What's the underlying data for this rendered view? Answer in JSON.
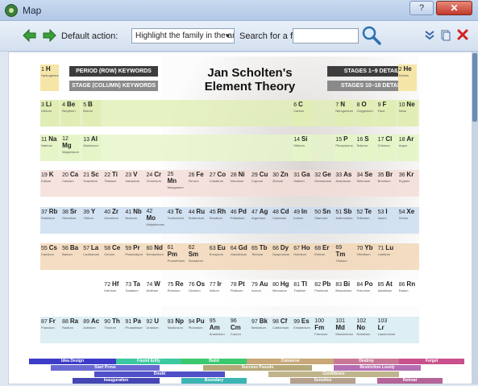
{
  "window": {
    "title": "Map",
    "help_label": "?",
    "close_label": "✕"
  },
  "toolbar": {
    "default_action_label": "Default action:",
    "default_action_value": "Highlight the family in the analysis",
    "search_label": "Search for a family:",
    "search_value": ""
  },
  "chart": {
    "title_line1": "Jan Scholten's",
    "title_line2": "Element Theory",
    "btn_period": "PERIOD (ROW) KEYWORDS",
    "btn_stage": "STAGE (COLUMN) KEYWORDS",
    "btn_stages_1_9": "STAGES 1–9 DETAIL",
    "btn_stages_10_18": "STAGES 10–18 DETAIL"
  },
  "elements": [
    {
      "n": "1",
      "s": "H",
      "name": "Hydrogenium",
      "row": 0,
      "col": 0
    },
    {
      "n": "2",
      "s": "He",
      "name": "Helium",
      "row": 0,
      "col": 17
    },
    {
      "n": "3",
      "s": "Li",
      "name": "Lithium",
      "row": 1,
      "col": 0
    },
    {
      "n": "4",
      "s": "Be",
      "name": "Beryllium",
      "row": 1,
      "col": 1
    },
    {
      "n": "5",
      "s": "B",
      "name": "Borum",
      "row": 1,
      "col": 2
    },
    {
      "n": "6",
      "s": "C",
      "name": "Carbon",
      "row": 1,
      "col": 12
    },
    {
      "n": "7",
      "s": "N",
      "name": "Nitrogenium",
      "row": 1,
      "col": 14
    },
    {
      "n": "8",
      "s": "O",
      "name": "Oxygenium",
      "row": 1,
      "col": 15
    },
    {
      "n": "9",
      "s": "F",
      "name": "Fluor",
      "row": 1,
      "col": 16
    },
    {
      "n": "10",
      "s": "Ne",
      "name": "Neon",
      "row": 1,
      "col": 17
    },
    {
      "n": "11",
      "s": "Na",
      "name": "Natrium",
      "row": 2,
      "col": 0
    },
    {
      "n": "12",
      "s": "Mg",
      "name": "Magnesium",
      "row": 2,
      "col": 1
    },
    {
      "n": "13",
      "s": "Al",
      "name": "Aluminium",
      "row": 2,
      "col": 2
    },
    {
      "n": "14",
      "s": "Si",
      "name": "Silicium",
      "row": 2,
      "col": 12
    },
    {
      "n": "15",
      "s": "P",
      "name": "Phosphorus",
      "row": 2,
      "col": 14
    },
    {
      "n": "16",
      "s": "S",
      "name": "Sulphur",
      "row": 2,
      "col": 15
    },
    {
      "n": "17",
      "s": "Cl",
      "name": "Chlorum",
      "row": 2,
      "col": 16
    },
    {
      "n": "18",
      "s": "Ar",
      "name": "Argon",
      "row": 2,
      "col": 17
    },
    {
      "n": "19",
      "s": "K",
      "name": "Kalium",
      "row": 3,
      "col": 0
    },
    {
      "n": "20",
      "s": "Ca",
      "name": "Calcium",
      "row": 3,
      "col": 1
    },
    {
      "n": "21",
      "s": "Sc",
      "name": "Scandium",
      "row": 3,
      "col": 2
    },
    {
      "n": "22",
      "s": "Ti",
      "name": "Titanium",
      "row": 3,
      "col": 3
    },
    {
      "n": "23",
      "s": "V",
      "name": "Vanadium",
      "row": 3,
      "col": 4
    },
    {
      "n": "24",
      "s": "Cr",
      "name": "Chromium",
      "row": 3,
      "col": 5
    },
    {
      "n": "25",
      "s": "Mn",
      "name": "Manganum",
      "row": 3,
      "col": 6
    },
    {
      "n": "26",
      "s": "Fe",
      "name": "Ferrum",
      "row": 3,
      "col": 7
    },
    {
      "n": "27",
      "s": "Co",
      "name": "Cobaltum",
      "row": 3,
      "col": 8
    },
    {
      "n": "28",
      "s": "Ni",
      "name": "Niccolum",
      "row": 3,
      "col": 9
    },
    {
      "n": "29",
      "s": "Cu",
      "name": "Cuprum",
      "row": 3,
      "col": 10
    },
    {
      "n": "30",
      "s": "Zn",
      "name": "Zincum",
      "row": 3,
      "col": 11
    },
    {
      "n": "31",
      "s": "Ga",
      "name": "Gallium",
      "row": 3,
      "col": 12
    },
    {
      "n": "32",
      "s": "Ge",
      "name": "Germanium",
      "row": 3,
      "col": 13
    },
    {
      "n": "33",
      "s": "As",
      "name": "Arsenicum",
      "row": 3,
      "col": 14
    },
    {
      "n": "34",
      "s": "Se",
      "name": "Selenium",
      "row": 3,
      "col": 15
    },
    {
      "n": "35",
      "s": "Br",
      "name": "Bromium",
      "row": 3,
      "col": 16
    },
    {
      "n": "36",
      "s": "Kr",
      "name": "Krypton",
      "row": 3,
      "col": 17
    },
    {
      "n": "37",
      "s": "Rb",
      "name": "Rubidium",
      "row": 4,
      "col": 0
    },
    {
      "n": "38",
      "s": "Sr",
      "name": "Strontium",
      "row": 4,
      "col": 1
    },
    {
      "n": "39",
      "s": "Y",
      "name": "Yttrium",
      "row": 4,
      "col": 2
    },
    {
      "n": "40",
      "s": "Zr",
      "name": "Zirconium",
      "row": 4,
      "col": 3
    },
    {
      "n": "41",
      "s": "Nb",
      "name": "Niobium",
      "row": 4,
      "col": 4
    },
    {
      "n": "42",
      "s": "Mo",
      "name": "Molybdenum",
      "row": 4,
      "col": 5
    },
    {
      "n": "43",
      "s": "Tc",
      "name": "Technetium",
      "row": 4,
      "col": 6
    },
    {
      "n": "44",
      "s": "Ru",
      "name": "Ruthenium",
      "row": 4,
      "col": 7
    },
    {
      "n": "45",
      "s": "Rh",
      "name": "Rhodium",
      "row": 4,
      "col": 8
    },
    {
      "n": "46",
      "s": "Pd",
      "name": "Palladium",
      "row": 4,
      "col": 9
    },
    {
      "n": "47",
      "s": "Ag",
      "name": "Argentum",
      "row": 4,
      "col": 10
    },
    {
      "n": "48",
      "s": "Cd",
      "name": "Cadmium",
      "row": 4,
      "col": 11
    },
    {
      "n": "49",
      "s": "In",
      "name": "Indium",
      "row": 4,
      "col": 12
    },
    {
      "n": "50",
      "s": "Sn",
      "name": "Stannum",
      "row": 4,
      "col": 13
    },
    {
      "n": "51",
      "s": "Sb",
      "name": "Antimonium",
      "row": 4,
      "col": 14
    },
    {
      "n": "52",
      "s": "Te",
      "name": "Tellurium",
      "row": 4,
      "col": 15
    },
    {
      "n": "53",
      "s": "I",
      "name": "Iodum",
      "row": 4,
      "col": 16
    },
    {
      "n": "54",
      "s": "Xe",
      "name": "Xenon",
      "row": 4,
      "col": 17
    },
    {
      "n": "55",
      "s": "Cs",
      "name": "Caesium",
      "row": 5,
      "col": 0
    },
    {
      "n": "56",
      "s": "Ba",
      "name": "Barium",
      "row": 5,
      "col": 1
    },
    {
      "n": "57",
      "s": "La",
      "name": "Lanthanum",
      "row": 5,
      "col": 2
    },
    {
      "n": "58",
      "s": "Ce",
      "name": "Cerium",
      "row": 5,
      "col": 3
    },
    {
      "n": "59",
      "s": "Pr",
      "name": "Praseodymium",
      "row": 5,
      "col": 4
    },
    {
      "n": "60",
      "s": "Nd",
      "name": "Neodymium",
      "row": 5,
      "col": 5
    },
    {
      "n": "61",
      "s": "Pm",
      "name": "Promethium",
      "row": 5,
      "col": 6
    },
    {
      "n": "62",
      "s": "Sm",
      "name": "Samarium",
      "row": 5,
      "col": 7
    },
    {
      "n": "63",
      "s": "Eu",
      "name": "Europium",
      "row": 5,
      "col": 8
    },
    {
      "n": "64",
      "s": "Gd",
      "name": "Gadolinium",
      "row": 5,
      "col": 9
    },
    {
      "n": "65",
      "s": "Tb",
      "name": "Terbium",
      "row": 5,
      "col": 10
    },
    {
      "n": "66",
      "s": "Dy",
      "name": "Dysprosium",
      "row": 5,
      "col": 11
    },
    {
      "n": "67",
      "s": "Ho",
      "name": "Holmium",
      "row": 5,
      "col": 12
    },
    {
      "n": "68",
      "s": "Er",
      "name": "Erbium",
      "row": 5,
      "col": 13
    },
    {
      "n": "69",
      "s": "Tm",
      "name": "Thulium",
      "row": 5,
      "col": 14
    },
    {
      "n": "70",
      "s": "Yb",
      "name": "Ytterbium",
      "row": 5,
      "col": 15
    },
    {
      "n": "71",
      "s": "Lu",
      "name": "Lutetium",
      "row": 5,
      "col": 16
    },
    {
      "n": "72",
      "s": "Hf",
      "name": "Hafnium",
      "row": 6,
      "col": 3
    },
    {
      "n": "73",
      "s": "Ta",
      "name": "Tantalum",
      "row": 6,
      "col": 4
    },
    {
      "n": "74",
      "s": "W",
      "name": "Wolfram",
      "row": 6,
      "col": 5
    },
    {
      "n": "75",
      "s": "Re",
      "name": "Rhenium",
      "row": 6,
      "col": 6
    },
    {
      "n": "76",
      "s": "Os",
      "name": "Osmium",
      "row": 6,
      "col": 7
    },
    {
      "n": "77",
      "s": "Ir",
      "name": "Iridium",
      "row": 6,
      "col": 8
    },
    {
      "n": "78",
      "s": "Pt",
      "name": "Platinum",
      "row": 6,
      "col": 9
    },
    {
      "n": "79",
      "s": "Au",
      "name": "Aurum",
      "row": 6,
      "col": 10
    },
    {
      "n": "80",
      "s": "Hg",
      "name": "Mercurius",
      "row": 6,
      "col": 11
    },
    {
      "n": "81",
      "s": "Tl",
      "name": "Thallium",
      "row": 6,
      "col": 12
    },
    {
      "n": "82",
      "s": "Pb",
      "name": "Plumbum",
      "row": 6,
      "col": 13
    },
    {
      "n": "83",
      "s": "Bi",
      "name": "Bismuthum",
      "row": 6,
      "col": 14
    },
    {
      "n": "84",
      "s": "Po",
      "name": "Polonium",
      "row": 6,
      "col": 15
    },
    {
      "n": "85",
      "s": "At",
      "name": "Astatinum",
      "row": 6,
      "col": 16
    },
    {
      "n": "86",
      "s": "Rn",
      "name": "Radon",
      "row": 6,
      "col": 17
    },
    {
      "n": "87",
      "s": "Fr",
      "name": "Francium",
      "row": 7,
      "col": 0
    },
    {
      "n": "88",
      "s": "Ra",
      "name": "Radium",
      "row": 7,
      "col": 1
    },
    {
      "n": "89",
      "s": "Ac",
      "name": "Actinium",
      "row": 7,
      "col": 2
    },
    {
      "n": "90",
      "s": "Th",
      "name": "Thorium",
      "row": 7,
      "col": 3
    },
    {
      "n": "91",
      "s": "Pa",
      "name": "Protactinium",
      "row": 7,
      "col": 4
    },
    {
      "n": "92",
      "s": "U",
      "name": "Uranium",
      "row": 7,
      "col": 5
    },
    {
      "n": "93",
      "s": "Np",
      "name": "Neptunium",
      "row": 7,
      "col": 6
    },
    {
      "n": "94",
      "s": "Pu",
      "name": "Plutonium",
      "row": 7,
      "col": 7
    },
    {
      "n": "95",
      "s": "Am",
      "name": "Americium",
      "row": 7,
      "col": 8
    },
    {
      "n": "96",
      "s": "Cm",
      "name": "Curium",
      "row": 7,
      "col": 9
    },
    {
      "n": "97",
      "s": "Bk",
      "name": "Berkelium",
      "row": 7,
      "col": 10
    },
    {
      "n": "98",
      "s": "Cf",
      "name": "Californium",
      "row": 7,
      "col": 11
    },
    {
      "n": "99",
      "s": "Es",
      "name": "Einsteinium",
      "row": 7,
      "col": 12
    },
    {
      "n": "100",
      "s": "Fm",
      "name": "Fermium",
      "row": 7,
      "col": 13
    },
    {
      "n": "101",
      "s": "Md",
      "name": "Mendelevium",
      "row": 7,
      "col": 14
    },
    {
      "n": "102",
      "s": "No",
      "name": "Nobelium",
      "row": 7,
      "col": 15
    },
    {
      "n": "103",
      "s": "Lr",
      "name": "Lawrencium",
      "row": 7,
      "col": 16
    }
  ],
  "row_colors": [
    "#f5e6a8",
    "#e0edb5",
    "#e6f5c8",
    "#f4dcd7",
    "#c9dcf0",
    "#f1d4b3",
    "#ffffff",
    "#d6eaf2"
  ],
  "stage_bars": [
    {
      "label": "Idea Design",
      "color": "#3c3cc8",
      "row": 0,
      "start": 0,
      "end": 4
    },
    {
      "label": "Found Edify",
      "color": "#3cc8a0",
      "row": 0,
      "start": 4,
      "end": 7
    },
    {
      "label": "Build",
      "color": "#3cc86e",
      "row": 0,
      "start": 7,
      "end": 10
    },
    {
      "label": "Conserve",
      "color": "#c8a878",
      "row": 0,
      "start": 10,
      "end": 14
    },
    {
      "label": "Destroy",
      "color": "#c87896",
      "row": 0,
      "start": 14,
      "end": 17
    },
    {
      "label": "Forget",
      "color": "#c8508c",
      "row": 0,
      "start": 17,
      "end": 20
    },
    {
      "label": "Start Prove",
      "color": "#6a6ad2",
      "row": 1,
      "start": 1,
      "end": 6
    },
    {
      "label": "Success Pseudo",
      "color": "#b4a878",
      "row": 1,
      "start": 8,
      "end": 13
    },
    {
      "label": "Restriction Lovely",
      "color": "#b46eb4",
      "row": 1,
      "start": 14,
      "end": 18
    },
    {
      "label": "Doubt",
      "color": "#5050c8",
      "row": 2,
      "start": 3,
      "end": 9
    },
    {
      "label": "Confidence",
      "color": "#c0b48c",
      "row": 2,
      "start": 11,
      "end": 17
    },
    {
      "label": "Inauguration",
      "color": "#4646b4",
      "row": 3,
      "start": 2,
      "end": 6
    },
    {
      "label": "Boundary",
      "color": "#3cb4b4",
      "row": 3,
      "start": 7,
      "end": 10
    },
    {
      "label": "Sensitive",
      "color": "#b4a08c",
      "row": 3,
      "start": 12,
      "end": 15
    },
    {
      "label": "Retreat",
      "color": "#b46496",
      "row": 3,
      "start": 16,
      "end": 19
    }
  ]
}
